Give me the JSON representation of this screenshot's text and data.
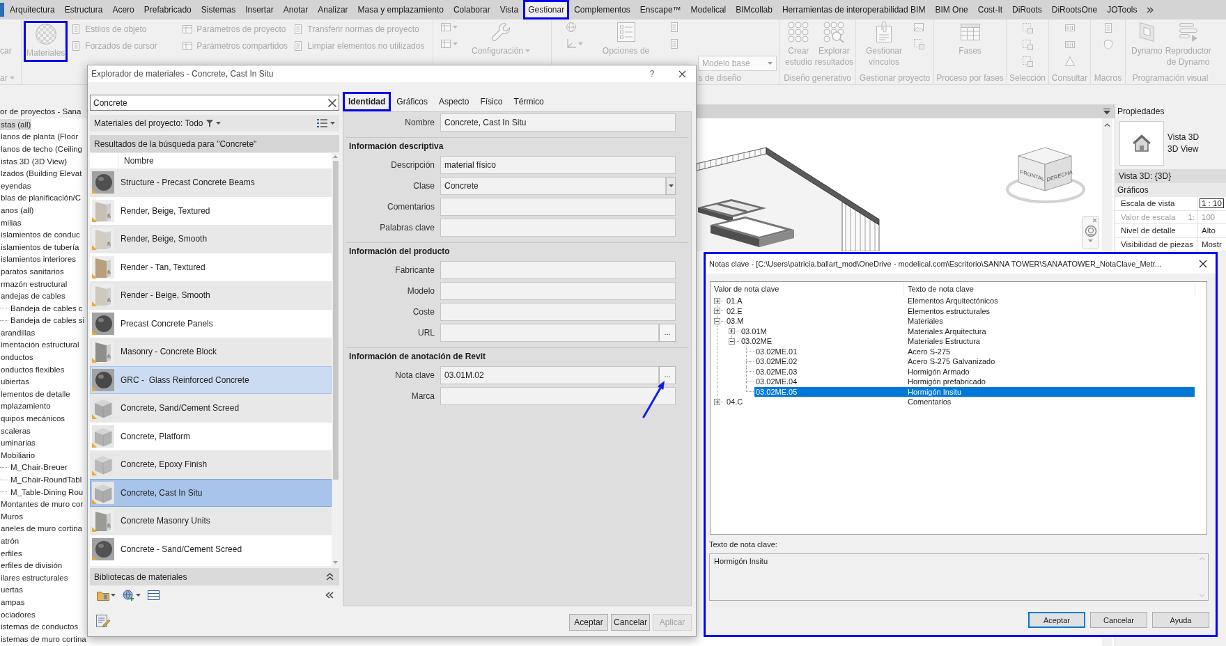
{
  "ribbon": {
    "disabled": true,
    "tabs": [
      {
        "label": "Arquitectura",
        "selected": false,
        "annotated": false
      },
      {
        "label": "Estructura",
        "selected": false,
        "annotated": false
      },
      {
        "label": "Acero",
        "selected": false,
        "annotated": false
      },
      {
        "label": "Prefabricado",
        "selected": false,
        "annotated": false
      },
      {
        "label": "Sistemas",
        "selected": false,
        "annotated": false
      },
      {
        "label": "Insertar",
        "selected": false,
        "annotated": false
      },
      {
        "label": "Anotar",
        "selected": false,
        "annotated": false
      },
      {
        "label": "Analizar",
        "selected": false,
        "annotated": false
      },
      {
        "label": "Masa y emplazamiento",
        "selected": false,
        "annotated": false
      },
      {
        "label": "Colaborar",
        "selected": false,
        "annotated": false
      },
      {
        "label": "Vista",
        "selected": false,
        "annotated": false
      },
      {
        "label": "Gestionar",
        "selected": true,
        "annotated": true
      },
      {
        "label": "Complementos",
        "selected": false,
        "annotated": false
      },
      {
        "label": "Enscape™",
        "selected": false,
        "annotated": false
      },
      {
        "label": "Modelical",
        "selected": false,
        "annotated": false
      },
      {
        "label": "BIMcollab",
        "selected": false,
        "annotated": false
      },
      {
        "label": "Herramientas de interoperabilidad BIM",
        "selected": false,
        "annotated": false
      },
      {
        "label": "BIM One",
        "selected": false,
        "annotated": false
      },
      {
        "label": "Cost-It",
        "selected": false,
        "annotated": false
      },
      {
        "label": "DiRoots",
        "selected": false,
        "annotated": false
      },
      {
        "label": "DiRootsOne",
        "selected": false,
        "annotated": false
      },
      {
        "label": "JOTools",
        "selected": false,
        "annotated": false
      }
    ],
    "panels": [
      {
        "label": {
          "text": "ar",
          "caret": true
        },
        "items": [
          {
            "kind": "large",
            "lines": [
              "car"
            ],
            "annotated": false,
            "caret": false
          }
        ]
      },
      {
        "items": [
          {
            "kind": "large",
            "lines": [
              "Materiales"
            ],
            "annotated": true,
            "caret": false
          },
          {
            "kind": "small-column",
            "buttons": [
              "Estilos de objeto",
              "Forzados de cursor"
            ]
          },
          {
            "kind": "small-column",
            "buttons": [
              "Parámetros de proyecto",
              "Parámetros compartidos"
            ]
          },
          {
            "kind": "small-column",
            "buttons": [
              "Transferir normas de proyecto",
              "Limpiar elementos no utilizados"
            ]
          }
        ]
      },
      {
        "items": [
          {
            "kind": "icon-column",
            "buttons": [
              {
                "caret": true
              },
              {
                "caret": true
              }
            ]
          },
          {
            "kind": "large",
            "lines": [
              "Configuración"
            ],
            "annotated": false,
            "caret": true
          }
        ]
      },
      {
        "label": {
          "text": "s de diseño",
          "caret": false
        },
        "items": [
          {
            "kind": "icon-column",
            "buttons": [
              {
                "caret": false
              },
              {
                "caret": true
              }
            ]
          },
          {
            "kind": "large",
            "lines": [
              "Opciones de"
            ],
            "annotated": false,
            "caret": false
          },
          {
            "kind": "icon-column",
            "buttons": [
              {
                "caret": false
              },
              {
                "caret": false
              }
            ]
          },
          {
            "kind": "dropdown",
            "value": "Modelo base"
          }
        ]
      },
      {
        "label": {
          "text": "Diseño generativo",
          "caret": false
        },
        "items": [
          {
            "kind": "large",
            "lines": [
              "Crear",
              "estudio"
            ],
            "annotated": false,
            "caret": false
          },
          {
            "kind": "large",
            "lines": [
              "Explorar",
              "resultados"
            ],
            "annotated": false,
            "caret": false
          }
        ]
      },
      {
        "label": {
          "text": "Gestionar proyecto",
          "caret": false
        },
        "items": [
          {
            "kind": "large",
            "lines": [
              "Gestionar",
              "vínculos"
            ],
            "annotated": false,
            "caret": false
          },
          {
            "kind": "icon-column",
            "buttons": [
              {
                "caret": false
              },
              {
                "caret": false
              }
            ]
          }
        ]
      },
      {
        "label": {
          "text": "Proceso por fases",
          "caret": false
        },
        "items": [
          {
            "kind": "large",
            "lines": [
              "Fases"
            ],
            "annotated": false,
            "caret": false
          }
        ]
      },
      {
        "label": {
          "text": "Selección",
          "caret": false
        },
        "items": [
          {
            "kind": "icon-column",
            "buttons": [
              {
                "caret": false
              },
              {
                "caret": false
              },
              {
                "caret": false
              }
            ]
          }
        ]
      },
      {
        "label": {
          "text": "Consultar",
          "caret": false
        },
        "items": [
          {
            "kind": "icon-column",
            "buttons": [
              {
                "caret": false
              },
              {
                "caret": false
              },
              {
                "caret": false
              }
            ]
          }
        ]
      },
      {
        "label": {
          "text": "Macros",
          "caret": false
        },
        "items": [
          {
            "kind": "icon-column",
            "buttons": [
              {
                "caret": false
              },
              {
                "caret": false
              }
            ]
          }
        ]
      },
      {
        "label": {
          "text": "Programación visual",
          "caret": false
        },
        "items": [
          {
            "kind": "large",
            "lines": [
              "Dynamo"
            ],
            "annotated": false,
            "caret": false
          },
          {
            "kind": "large",
            "lines": [
              "Reproductor",
              "de Dynamo"
            ],
            "annotated": false,
            "caret": false
          }
        ]
      }
    ]
  },
  "project_browser": {
    "title": "or de proyectos - Sana",
    "items": [
      {
        "label": "stas (all)",
        "selected": true
      },
      {
        "label": "lanos de planta (Floor",
        "selected": false
      },
      {
        "label": "lanos de techo (Ceiling",
        "selected": false
      },
      {
        "label": "istas 3D (3D View)",
        "selected": false
      },
      {
        "label": "lzados (Building Elevat",
        "selected": false
      },
      {
        "label": "eyendas",
        "selected": false
      },
      {
        "label": "blas de planificación/C",
        "selected": false
      },
      {
        "label": "anos (all)",
        "selected": false
      },
      {
        "label": "milias",
        "selected": false
      },
      {
        "label": "islamientos de conduc",
        "selected": false
      },
      {
        "label": "islamientos de tubería",
        "selected": false
      },
      {
        "label": "islamientos interiores",
        "selected": false
      },
      {
        "label": "paratos sanitarios",
        "selected": false
      },
      {
        "label": "rmazón estructural",
        "selected": false
      },
      {
        "label": "andejas de cables",
        "selected": false,
        "children": [
          {
            "label": "Bandeja de cables c",
            "selected": false
          },
          {
            "label": "Bandeja de cables si",
            "selected": false
          }
        ]
      },
      {
        "label": "arandillas",
        "selected": false
      },
      {
        "label": "imentación estructural",
        "selected": false
      },
      {
        "label": "onductos",
        "selected": false
      },
      {
        "label": "onductos flexibles",
        "selected": false
      },
      {
        "label": "ubiertas",
        "selected": false
      },
      {
        "label": "lementos de detalle",
        "selected": false
      },
      {
        "label": "mplazamiento",
        "selected": false
      },
      {
        "label": "quipos mecánicos",
        "selected": false
      },
      {
        "label": "scaleras",
        "selected": false
      },
      {
        "label": "uminarias",
        "selected": false
      },
      {
        "label": "Mobiliario",
        "selected": false,
        "children": [
          {
            "label": "M_Chair-Breuer",
            "selected": false
          },
          {
            "label": "M_Chair-RoundTabl",
            "selected": false
          },
          {
            "label": "M_Table-Dining Rou",
            "selected": false
          }
        ]
      },
      {
        "label": "Montantes de muro cor",
        "selected": false
      },
      {
        "label": "Muros",
        "selected": false
      },
      {
        "label": "aneles de muro cortina",
        "selected": false
      },
      {
        "label": "atrón",
        "selected": false
      },
      {
        "label": "erfiles",
        "selected": false
      },
      {
        "label": "erfiles de división",
        "selected": false
      },
      {
        "label": "ilares estructurales",
        "selected": false
      },
      {
        "label": "uertas",
        "selected": false
      },
      {
        "label": "ampas",
        "selected": false
      },
      {
        "label": "ociadores",
        "selected": false
      },
      {
        "label": "istemas de conductos",
        "selected": false
      },
      {
        "label": "istemas de muro cortina",
        "selected": false
      }
    ]
  },
  "viewport": {
    "view_cube": [
      "FRONTAL",
      "DERECHA"
    ]
  },
  "properties": {
    "title": "Propiedades",
    "type_name": "Vista 3D",
    "type_detail": "3D View",
    "selector": "Vista 3D: {3D}",
    "group": "Gráficos",
    "rows": [
      {
        "label": "Escala de vista",
        "value": "1 : 10",
        "disabled": false,
        "editing": true
      },
      {
        "label": "Valor de escala",
        "unit": "1:",
        "value": "100",
        "disabled": true,
        "editing": false
      },
      {
        "label": "Nivel de detalle",
        "value": "Alto",
        "disabled": false,
        "editing": false
      },
      {
        "label": "Visibilidad de piezas",
        "value": "Mostr",
        "disabled": false,
        "editing": false
      }
    ]
  },
  "material_browser": {
    "title": "Explorador de materiales - Concrete, Cast In Situ",
    "help": "?",
    "search": "Concrete",
    "filter_label": "Materiales del proyecto: Todo",
    "results_header": "Resultados de la búsqueda para \"Concrete\"",
    "column": "Nombre",
    "items": [
      {
        "name": "Structure - Precast Concrete Beams",
        "kind": "sphere",
        "color": "#505050",
        "selected": false,
        "hovered": false
      },
      {
        "name": "Render, Beige, Textured",
        "kind": "wall",
        "color": "#c8c0b5",
        "selected": false,
        "hovered": false
      },
      {
        "name": "Render, Beige, Smooth",
        "kind": "wall",
        "color": "#d3ccc3",
        "selected": false,
        "hovered": false
      },
      {
        "name": "Render - Tan, Textured",
        "kind": "wall",
        "color": "#b99f7c",
        "selected": false,
        "hovered": false
      },
      {
        "name": "Render - Beige, Smooth",
        "kind": "wall",
        "color": "#cfc8bf",
        "selected": false,
        "hovered": false
      },
      {
        "name": "Precast Concrete Panels",
        "kind": "sphere",
        "color": "#4c4c4c",
        "selected": false,
        "hovered": false
      },
      {
        "name": "Masonry - Concrete Block",
        "kind": "wall",
        "color": "#8e8f8a",
        "selected": false,
        "hovered": false
      },
      {
        "name": "GRC -  Glass Reinforced Concrete",
        "kind": "sphere",
        "color": "#484848",
        "selected": false,
        "hovered": true
      },
      {
        "name": "Concrete, Sand/Cement Screed",
        "kind": "cube",
        "color": "#a9a9a9",
        "selected": false,
        "hovered": false
      },
      {
        "name": "Concrete, Platform",
        "kind": "cube",
        "color": "#b2b2b2",
        "selected": false,
        "hovered": false
      },
      {
        "name": "Concrete, Epoxy Finish",
        "kind": "cube",
        "color": "#b8b8b8",
        "selected": false,
        "hovered": false
      },
      {
        "name": "Concrete, Cast In Situ",
        "kind": "cube",
        "color": "#acacac",
        "selected": true,
        "hovered": false
      },
      {
        "name": "Concrete Masonry Units",
        "kind": "wall",
        "color": "#9a9b95",
        "selected": false,
        "hovered": false
      },
      {
        "name": "Concrete - Sand/Cement Screed",
        "kind": "sphere",
        "color": "#525252",
        "selected": false,
        "hovered": false
      }
    ],
    "libraries": "Bibliotecas de materiales",
    "tabs": [
      {
        "label": "Identidad",
        "selected": true,
        "annotated": true
      },
      {
        "label": "Gráficos",
        "selected": false,
        "annotated": false
      },
      {
        "label": "Aspecto",
        "selected": false,
        "annotated": false
      },
      {
        "label": "Físico",
        "selected": false,
        "annotated": false
      },
      {
        "label": "Térmico",
        "selected": false,
        "annotated": false
      }
    ],
    "fields": [
      {
        "kind": "field",
        "label": "Nombre",
        "value": "Concrete, Cast In Situ"
      },
      {
        "kind": "section",
        "label": "Información descriptiva"
      },
      {
        "kind": "field",
        "label": "Descripción",
        "value": "material físico"
      },
      {
        "kind": "select",
        "label": "Clase",
        "value": "Concrete"
      },
      {
        "kind": "field",
        "label": "Comentarios"
      },
      {
        "kind": "field",
        "label": "Palabras clave"
      },
      {
        "kind": "section",
        "label": "Información del producto"
      },
      {
        "kind": "field",
        "label": "Fabricante"
      },
      {
        "kind": "field",
        "label": "Modelo"
      },
      {
        "kind": "field",
        "label": "Coste"
      },
      {
        "kind": "browse",
        "label": "URL",
        "browse": "...",
        "annotated": false
      },
      {
        "kind": "section",
        "label": "Información de anotación de Revit"
      },
      {
        "kind": "browse",
        "label": "Nota clave",
        "value": "03.01M.02",
        "browse": "...",
        "annotated": true
      },
      {
        "kind": "field",
        "label": "Marca"
      }
    ],
    "buttons": [
      {
        "label": "Aceptar",
        "disabled": false
      },
      {
        "label": "Cancelar",
        "disabled": false
      },
      {
        "label": "Aplicar",
        "disabled": true
      }
    ]
  },
  "keynotes": {
    "title": "Notas clave - [C:\\Users\\patricia.ballart_mod\\OneDrive - modelical.com\\Escritorio\\SANNA TOWER\\SANAATOWER_NotaClave_Metr...",
    "annotated": true,
    "columns": [
      "Valor de nota clave",
      "Texto de nota clave"
    ],
    "tree": [
      {
        "value": "01.A",
        "text": "Elementos Arquitectónicos",
        "expanded": false,
        "selected": false
      },
      {
        "value": "02.E",
        "text": "Elementos estructurales",
        "expanded": false,
        "selected": false
      },
      {
        "value": "03.M",
        "text": "Materiales",
        "expanded": true,
        "selected": false,
        "children": [
          {
            "value": "03.01M",
            "text": "Materiales Arquitectura",
            "expanded": false,
            "selected": false
          },
          {
            "value": "03.02ME",
            "text": "Materiales Estructura",
            "expanded": true,
            "selected": false,
            "children": [
              {
                "value": "03.02ME.01",
                "text": "Acero S-275",
                "selected": false
              },
              {
                "value": "03.02ME.02",
                "text": "Acero S-275 Galvanizado",
                "selected": false
              },
              {
                "value": "03.02ME.03",
                "text": "Hormigón Armado",
                "selected": false
              },
              {
                "value": "03.02ME.04",
                "text": "Hormigón prefabricado",
                "selected": false
              },
              {
                "value": "03.02ME.05",
                "text": "Hormigón Insitu",
                "selected": true
              }
            ]
          }
        ]
      },
      {
        "value": "04.C",
        "text": "Comentarios",
        "expanded": false,
        "selected": false
      }
    ],
    "text_label": "Texto de nota clave:",
    "text": "Hormigón Insitu",
    "buttons": [
      {
        "label": "Aceptar",
        "default": true
      },
      {
        "label": "Cancelar",
        "default": false
      },
      {
        "label": "Ayuda",
        "default": false
      }
    ]
  }
}
